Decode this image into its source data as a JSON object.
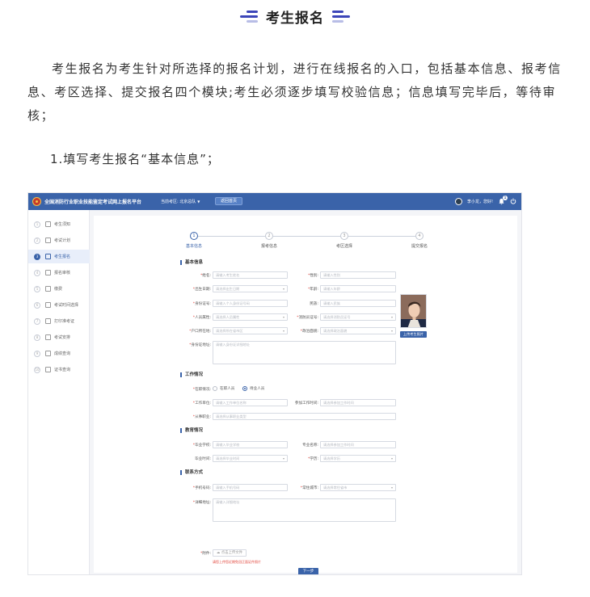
{
  "article": {
    "heading": "考生报名",
    "paragraph": "考生报名为考生针对所选择的报名计划，进行在线报名的入口，包括基本信息、报考信息、考区选择、提交报名四个模块;考生必须逐步填写校验信息；信息填写完毕后，等待审核；",
    "step_text": "1.填写考生报名“基本信息”；"
  },
  "app": {
    "platform_title": "全国消防行业职业技能鉴定考试网上报名平台",
    "exam_point": "当前考区: 北京总队",
    "home_button": "返回首页",
    "user_greeting": "李小龙，您好!",
    "notification_count": "1",
    "theme_color": "#3a63a9",
    "sidebar": [
      {
        "num": "1",
        "label": "考生须知",
        "icon": "doc-icon",
        "active": false
      },
      {
        "num": "2",
        "label": "考试计划",
        "icon": "calendar-icon",
        "active": false
      },
      {
        "num": "3",
        "label": "考生报名",
        "icon": "form-icon",
        "active": true
      },
      {
        "num": "4",
        "label": "报名审核",
        "icon": "check-icon",
        "active": false
      },
      {
        "num": "5",
        "label": "缴费",
        "icon": "payment-icon",
        "active": false
      },
      {
        "num": "6",
        "label": "考试时间选择",
        "icon": "clock-icon",
        "active": false
      },
      {
        "num": "7",
        "label": "打印准考证",
        "icon": "print-icon",
        "active": false
      },
      {
        "num": "8",
        "label": "考试安排",
        "icon": "schedule-icon",
        "active": false
      },
      {
        "num": "9",
        "label": "成绩查询",
        "icon": "search-icon",
        "active": false
      },
      {
        "num": "10",
        "label": "证书查询",
        "icon": "certificate-icon",
        "active": false
      }
    ],
    "steps": [
      {
        "num": "1",
        "label": "基本信息",
        "active": true
      },
      {
        "num": "2",
        "label": "报考信息",
        "active": false
      },
      {
        "num": "3",
        "label": "考区选择",
        "active": false
      },
      {
        "num": "4",
        "label": "提交报名",
        "active": false
      }
    ],
    "sections": {
      "basic": "基本信息",
      "work": "工作情况",
      "education": "教育情况",
      "contact": "联系方式"
    },
    "basic_fields": {
      "name": {
        "label": "姓名:",
        "placeholder": "请输入考生姓名"
      },
      "gender": {
        "label": "性别:",
        "placeholder": "请输入性别"
      },
      "birth_date": {
        "label": "出生日期:",
        "placeholder": "请选择出生日期"
      },
      "age": {
        "label": "年龄:",
        "placeholder": "请输入年龄"
      },
      "id_number": {
        "label": "身份证号:",
        "placeholder": "请输入个人身份证号码"
      },
      "ethnicity": {
        "label": "民族:",
        "placeholder": "请输入民族"
      },
      "person_type": {
        "label": "人员属性:",
        "placeholder": "请选择人员属性"
      },
      "fire_cert": {
        "label": "消防员证号:",
        "placeholder": "请选择消防员证号"
      },
      "hukou": {
        "label": "户口所在地:",
        "placeholder": "请选择所在省市区"
      },
      "political": {
        "label": "政治面貌:",
        "placeholder": "请选择政治面貌"
      },
      "id_address": {
        "label": "身份证地址:",
        "placeholder": "请输入身份证详细地址"
      },
      "photo_button": "上传考生照片"
    },
    "work_fields": {
      "status_label": "在职情况:",
      "status_options": [
        "在职人员",
        "待业人员"
      ],
      "employer": {
        "label": "工作单位:",
        "placeholder": "请输入工作单位名称"
      },
      "start_time": {
        "label": "参加工作时间:",
        "placeholder": "请选择参加工作时间"
      },
      "occupation": {
        "label": "从事职业:",
        "placeholder": "请选择从事职业类型"
      }
    },
    "education_fields": {
      "school": {
        "label": "毕业学校:",
        "placeholder": "请输入毕业学校"
      },
      "major": {
        "label": "专业名称:",
        "placeholder": "请选择参加工作时间"
      },
      "grad_time": {
        "label": "毕业时间:",
        "placeholder": "请选择毕业时间"
      },
      "degree": {
        "label": "学历:",
        "placeholder": "请选择学历"
      }
    },
    "contact_fields": {
      "phone": {
        "label": "手机号码:",
        "placeholder": "请输入手机号码"
      },
      "city": {
        "label": "常住城市:",
        "placeholder": "请选择常住省市"
      },
      "address": {
        "label": "详细地址:",
        "placeholder": "请输入详细地址"
      }
    },
    "attachment_label": "附件:",
    "upload_button": "点击上传文件",
    "upload_hint": "请您上传您近期免冠正面证件照片",
    "next_button": "下一步"
  }
}
